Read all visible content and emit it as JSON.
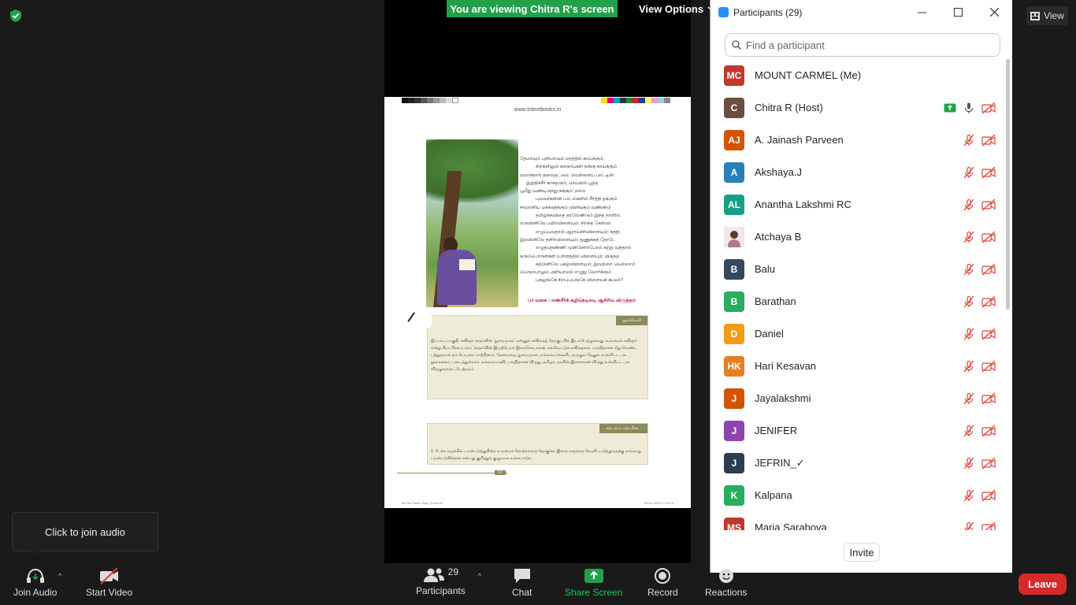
{
  "banner": {
    "viewing_text": "You are viewing Chitra R's screen",
    "view_options_label": "View Options"
  },
  "top_right": {
    "view_label": "View"
  },
  "shared_page": {
    "url": "www.tntextbooks.in",
    "poem_lines": [
      "தேமாவும் புளிமாவும் மரத்தில் காய்க்கும்;",
      "சிறகளிலும் கல்காய்கள் நன்கு காய்க்கும்",
      "ஏமாந்தால் தலைதட்டும்; வெள்ளைப் பாட்டின்",
      "இறுதிச்சீர் காசுதரும்; செய்யில் பூத்த",
      "பூமீது வண்டிருந்து நக்கும்; நல்ல",
      "புலவர்களின் பாடல்களில் சீர்த்தி தங்கும்",
      "சாமானிய மக்களுக்கும் விளங்கும் வண்ணம்",
      "தமிழ்க்கவிதை தரவேண்டும் இந்த நாளில்.",
      "",
      "எருவினிலே பயிர்விளையும்; சிறந்த கேள்வி",
      "எழுப்புவதால் ஆராய்ச்சிவிளையும்; கத்தி",
      "இரவினிலே தளிர்விளையும்; நுணுக்கத் தோடே",
      "எழுத்தெண்ணி முன்னோர்போல் கற்று வந்தால்",
      "கரும்பொருள்கள் உள்ளத்தில் விளையும்; மிகுந்த",
      "கற்பினிலே புகழ்விளையும்; இவற்றை யெல்லாம்",
      "பெரும்பாலும் அறியாமல் எழுது வோர்க்கும்",
      "புகலுங்கே சிறப்பெங்கே விளையக் கூடும்?"
    ],
    "poem_tag": "பா வகை : எண்சீர்க் கழிநெடிலடி ஆசிரிய விருத்தம்",
    "box1_header": "நூல்வெளி",
    "box1_text": "இப்பாடப்பகுதி, கவிஞர் சுரதாவின் ‘துறைமுகம்’ என்னும் கவிதைத் தொகுப்பில் இடம்பெற்றுள்ளது. உவமைக் கவிஞர் என்று சிறப்பிக்கப்படும் ‘சுரதா’வின் இயற்பெயர் இராசகோபாலன். கல்வெட்டுக் கவிதைகள், பாரதிதாசன் மீது கொண்ட பற்றுதலால் தம் பெயரை மாற்றினார். தேன்மழை, துறைமுகம், மங்கையர்க்கரசி, அமுதும் தேனும் உள்ளிட்ட பல நூல்களைப் படைத்துள்ளார். கலைமாமணி, பாரதிதாசன் விருது, தமிழக அரசின் இராசராசன் விருது உள்ளிட்ட பல விருதுகளைப் பெற்றவர்.",
    "box2_header": "கற்பவை கற்றபின்...",
    "box2_text": "1. பேச்சு வழக்கில் பயன்படுத்துகின்ற உவமைச் சொற்களைத் தொகுக்க. இவை கருத்தை வெளிப்படுத்துவதற்கு எவ்வாறு பயன்படுகின்றன என்பது குறித்துக் குழுவாக உரையாடுக.",
    "page_number": "57",
    "footer_left": "9th Std Tamil Chap_3.indd   57",
    "footer_right": "09-01-2020   17:14:14"
  },
  "participants_panel": {
    "title": "Participants (29)",
    "search_placeholder": "Find a participant",
    "invite_label": "Invite",
    "items": [
      {
        "initials": "MC",
        "name": "MOUNT CARMEL (Me)",
        "color": "#c0392b",
        "kind": "me"
      },
      {
        "initials": "C",
        "name": "Chitra R (Host)",
        "color": "#6d4c41",
        "kind": "host"
      },
      {
        "initials": "AJ",
        "name": "A. Jainash Parveen",
        "color": "#d35400",
        "kind": "muted"
      },
      {
        "initials": "A",
        "name": "Akshaya.J",
        "color": "#2980b9",
        "kind": "muted"
      },
      {
        "initials": "AL",
        "name": "Anantha Lakshmi RC",
        "color": "#16a085",
        "kind": "muted"
      },
      {
        "initials": "",
        "name": "Atchaya B",
        "color": "#b07a8a",
        "kind": "muted-photo"
      },
      {
        "initials": "B",
        "name": "Balu",
        "color": "#34495e",
        "kind": "muted"
      },
      {
        "initials": "B",
        "name": "Barathan",
        "color": "#27ae60",
        "kind": "muted"
      },
      {
        "initials": "D",
        "name": "Daniel",
        "color": "#f39c12",
        "kind": "muted"
      },
      {
        "initials": "HK",
        "name": "Hari Kesavan",
        "color": "#e67e22",
        "kind": "muted"
      },
      {
        "initials": "J",
        "name": "Jayalakshmi",
        "color": "#d35400",
        "kind": "muted"
      },
      {
        "initials": "J",
        "name": "JENIFER",
        "color": "#8e44ad",
        "kind": "muted"
      },
      {
        "initials": "J",
        "name": "JEFRIN_✓",
        "color": "#2c3e50",
        "kind": "muted"
      },
      {
        "initials": "K",
        "name": "Kalpana",
        "color": "#27ae60",
        "kind": "muted"
      },
      {
        "initials": "MS",
        "name": "Maria Sarabova",
        "color": "#c0392b",
        "kind": "muted"
      }
    ]
  },
  "tooltip": {
    "text": "Click to join audio"
  },
  "toolbar": {
    "join_audio": "Join Audio",
    "start_video": "Start Video",
    "participants": "Participants",
    "participants_count": "29",
    "chat": "Chat",
    "share_screen": "Share Screen",
    "record": "Record",
    "reactions": "Reactions",
    "leave": "Leave"
  },
  "colors": {
    "share_green": "#23a14a",
    "leave_red": "#d42a2a",
    "zoom_blue": "#2d8cff"
  },
  "icons": [
    "security-shield-icon",
    "view-icon",
    "chevron-down-icon",
    "minimize-icon",
    "maximize-icon",
    "close-icon",
    "search-icon",
    "headphones-icon",
    "video-off-icon",
    "participants-icon",
    "chat-icon",
    "share-screen-icon",
    "record-icon",
    "reactions-icon",
    "mic-icon",
    "mic-muted-icon",
    "video-muted-icon",
    "sharing-icon"
  ]
}
